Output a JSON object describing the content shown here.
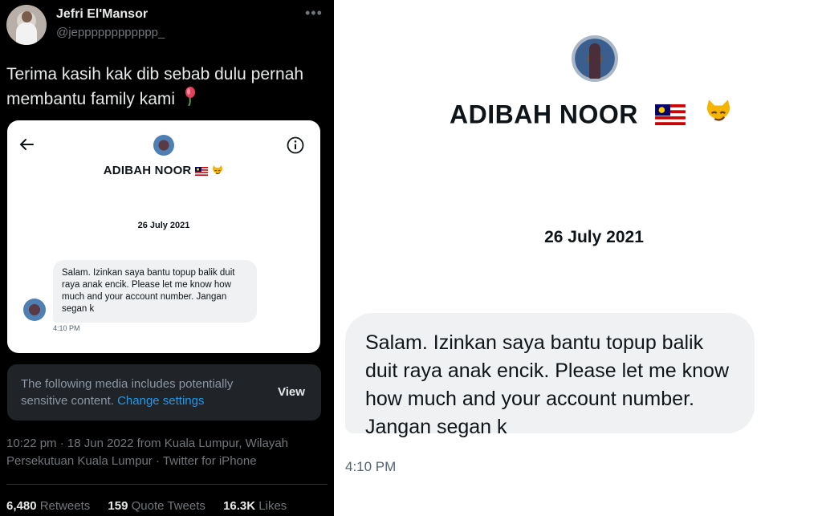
{
  "tweet": {
    "author_name": "Jefri El'Mansor",
    "author_handle": "@jepppppppppppp_",
    "more_icon": "more-horizontal-icon",
    "text": "Terima kasih kak dib sebab dulu pernah membantu family kami",
    "text_emoji": "wilted-flower-icon",
    "timestamp": "10:22 pm · 18 Jun 2022 from Kuala Lumpur, Wilayah Persekutuan Kuala Lumpur · Twitter for iPhone",
    "stats": {
      "retweets_count": "6,480",
      "retweets_label": "Retweets",
      "quotes_count": "159",
      "quotes_label": "Quote Tweets",
      "likes_count": "16.3K",
      "likes_label": "Likes"
    },
    "sensitive_notice": {
      "text": "The following media includes potentially sensitive content.",
      "link": "Change settings",
      "button": "View"
    }
  },
  "dm": {
    "profile_name": "ADIBAH NOOR",
    "name_emojis": [
      "malaysia-flag-icon",
      "smirking-cat-icon"
    ],
    "date": "26 July 2021",
    "message": "Salam. Izinkan saya bantu topup balik duit raya anak encik. Please let me know how much and your account number. Jangan segan k",
    "time": "4:10 PM"
  },
  "colors": {
    "tweet_bg": "#000000",
    "link_blue": "#1d9bf0",
    "bubble_bg": "#eff1f3",
    "muted_text": "#71767b"
  }
}
